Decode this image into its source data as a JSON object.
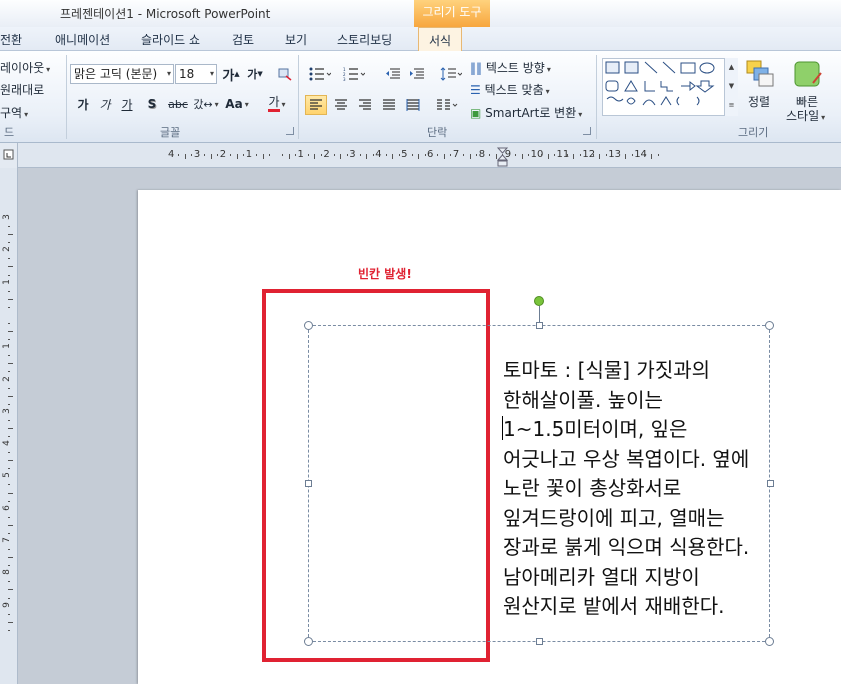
{
  "window": {
    "title": "프레젠테이션1  -  Microsoft PowerPoint",
    "contextual_tab_header": "그리기 도구"
  },
  "tabs": [
    {
      "label": "전환"
    },
    {
      "label": "애니메이션"
    },
    {
      "label": "슬라이드 쇼"
    },
    {
      "label": "검토"
    },
    {
      "label": "보기"
    },
    {
      "label": "스토리보딩"
    },
    {
      "label": "서식"
    }
  ],
  "ribbon": {
    "slides": {
      "layout_label": "레이아웃",
      "reset_label": "원래대로",
      "section_label": "구역",
      "group_label": "드"
    },
    "font": {
      "font_name": "맑은 고딕 (본문)",
      "font_size": "18",
      "grow_label": "가",
      "shrink_label": "가",
      "bold_label": "가",
      "italic_label": "가",
      "underline_label": "가",
      "shadow_label": "S",
      "strike_label": "abc",
      "spacing_label": "갔↔",
      "case_label": "Aa",
      "color_label": "가",
      "group_label": "글꼴"
    },
    "paragraph": {
      "text_direction_label": "텍스트 방향",
      "align_text_label": "텍스트 맞춤",
      "smartart_label": "SmartArt로 변환",
      "group_label": "단락"
    },
    "drawing": {
      "arrange_label": "정렬",
      "quick_styles_label_1": "빠른",
      "quick_styles_label_2": "스타일",
      "group_label": "그리기"
    }
  },
  "hruler_labels": [
    "4",
    "3",
    "2",
    "1",
    "",
    "1",
    "2",
    "3",
    "4",
    "5",
    "6",
    "7",
    "8",
    "9",
    "10",
    "11",
    "12",
    "13",
    "14"
  ],
  "vruler_labels": [
    "3",
    "2",
    "1",
    "",
    "1",
    "2",
    "3",
    "4",
    "5",
    "6",
    "7",
    "8",
    "9"
  ],
  "slide": {
    "annotation": "빈칸 발생!",
    "textbox_text": "토마토 : [식물] 가짓과의 한해살이풀. 높이는 1~1.5미터이며, 잎은 어긋나고 우상 복엽이다. 옆에 노란 꽃이 총상화서로 잎겨드랑이에 피고, 열매는 장과로 붉게 익으며 식용한다. 남아메리카 열대 지방이 원산지로 밭에서 재배한다.",
    "accent_red": "#e02232"
  }
}
